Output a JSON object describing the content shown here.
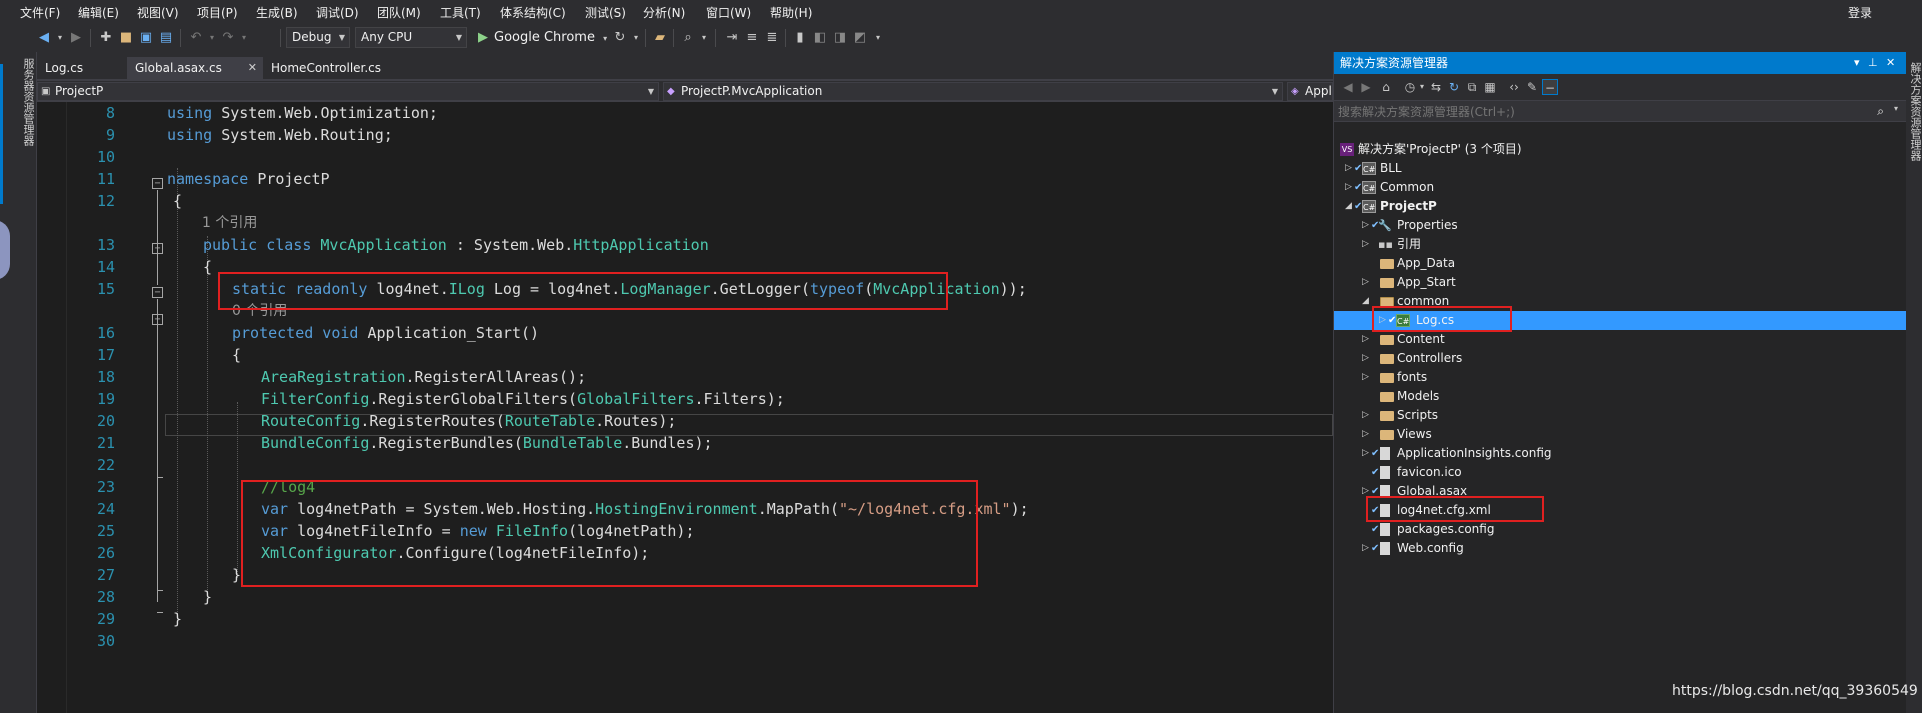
{
  "menu": [
    "文件(F)",
    "编辑(E)",
    "视图(V)",
    "项目(P)",
    "生成(B)",
    "调试(D)",
    "团队(M)",
    "工具(T)",
    "体系结构(C)",
    "测试(S)",
    "分析(N)",
    "窗口(W)",
    "帮助(H)"
  ],
  "login": "登录",
  "toolbar": {
    "config": "Debug",
    "platform": "Any CPU",
    "run_target": "Google Chrome"
  },
  "left_strip_label": "服务器资源管理器",
  "right_strip_label": "解决方案资源管理器",
  "tabs": [
    {
      "label": "Log.cs"
    },
    {
      "label": "Global.asax.cs",
      "active": true
    },
    {
      "label": "HomeController.cs"
    }
  ],
  "navbar": {
    "project": "ProjectP",
    "type": "ProjectP.MvcApplication",
    "member": "Appl"
  },
  "code": {
    "l8_ln": "8",
    "l8_a": "using ",
    "l8_b": "System.Web.Optimization;",
    "l9_ln": "9",
    "l9_a": "using ",
    "l9_b": "System.Web.Routing;",
    "l10_ln": "10",
    "l11_ln": "11",
    "l11_a": "namespace ",
    "l11_b": "ProjectP",
    "l12_ln": "12",
    "l12_a": "{",
    "ref1": "1 个引用",
    "l13_ln": "13",
    "l13_a": "public class ",
    "l13_b": "MvcApplication",
    "l13_c": " : System.Web.",
    "l13_d": "HttpApplication",
    "l14_ln": "14",
    "l14_a": "{",
    "l15_ln": "15",
    "l15_a": "static readonly ",
    "l15_b": "log4net.",
    "l15_c": "ILog",
    "l15_d": " Log = log4net.",
    "l15_e": "LogManager",
    "l15_f": ".GetLogger(",
    "l15_g": "typeof",
    "l15_h": "(",
    "l15_i": "MvcApplication",
    "l15_j": "));",
    "ref0": "0 个引用",
    "l16_ln": "16",
    "l16_a": "protected void ",
    "l16_b": "Application_Start()",
    "l17_ln": "17",
    "l17_a": "{",
    "l18_ln": "18",
    "l18_a": "AreaRegistration",
    "l18_b": ".RegisterAllAreas();",
    "l19_ln": "19",
    "l19_a": "FilterConfig",
    "l19_b": ".RegisterGlobalFilters(",
    "l19_c": "GlobalFilters",
    "l19_d": ".Filters);",
    "l20_ln": "20",
    "l20_a": "RouteConfig",
    "l20_b": ".RegisterRoutes(",
    "l20_c": "RouteTable",
    "l20_d": ".Routes);",
    "l21_ln": "21",
    "l21_a": "BundleConfig",
    "l21_b": ".RegisterBundles(",
    "l21_c": "BundleTable",
    "l21_d": ".Bundles);",
    "l22_ln": "22",
    "l23_ln": "23",
    "l23_a": "//log4",
    "l24_ln": "24",
    "l24_a": "var ",
    "l24_b": "log4netPath = System.Web.Hosting.",
    "l24_c": "HostingEnvironment",
    "l24_d": ".MapPath(",
    "l24_e": "\"~/log4net.cfg.xml\"",
    "l24_f": ");",
    "l25_ln": "25",
    "l25_a": "var ",
    "l25_b": "log4netFileInfo = ",
    "l25_c": "new ",
    "l25_d": "FileInfo",
    "l25_e": "(log4netPath);",
    "l26_ln": "26",
    "l26_a": "XmlConfigurator",
    "l26_b": ".Configure(log4netFileInfo);",
    "l27_ln": "27",
    "l27_a": "}",
    "l28_ln": "28",
    "l28_a": "}",
    "l29_ln": "29",
    "l29_a": "}",
    "l30_ln": "30"
  },
  "solution_explorer": {
    "title": "解决方案资源管理器",
    "search_placeholder": "搜索解决方案资源管理器(Ctrl+;)",
    "items": [
      {
        "label": "解决方案'ProjectP' (3 个项目)"
      },
      {
        "label": "BLL"
      },
      {
        "label": "Common"
      },
      {
        "label": "ProjectP"
      },
      {
        "label": "Properties"
      },
      {
        "label": "引用"
      },
      {
        "label": "App_Data"
      },
      {
        "label": "App_Start"
      },
      {
        "label": "common"
      },
      {
        "label": "Log.cs"
      },
      {
        "label": "Content"
      },
      {
        "label": "Controllers"
      },
      {
        "label": "fonts"
      },
      {
        "label": "Models"
      },
      {
        "label": "Scripts"
      },
      {
        "label": "Views"
      },
      {
        "label": "ApplicationInsights.config"
      },
      {
        "label": "favicon.ico"
      },
      {
        "label": "Global.asax"
      },
      {
        "label": "log4net.cfg.xml"
      },
      {
        "label": "packages.config"
      },
      {
        "label": "Web.config"
      }
    ]
  },
  "watermark": "https://blog.csdn.net/qq_39360549"
}
